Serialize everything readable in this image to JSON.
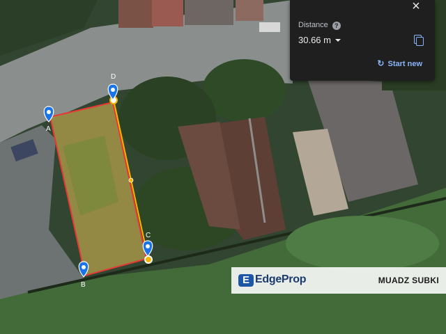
{
  "distance_panel": {
    "title": "Distance",
    "help_icon": "?",
    "value": "30.66 m",
    "close_icon": "×",
    "start_new_label": "Start new",
    "accent_color": "#8ab4f8"
  },
  "measure_points": {
    "a": "A",
    "b": "B",
    "c": "C",
    "d": "D"
  },
  "plot_outline_color": "#e53935",
  "measure_line_color": "#f4b400",
  "watermark": {
    "logo_mark": "E",
    "logo_text": "EdgeProp",
    "agent_name": "MUADZ SUBKI"
  }
}
